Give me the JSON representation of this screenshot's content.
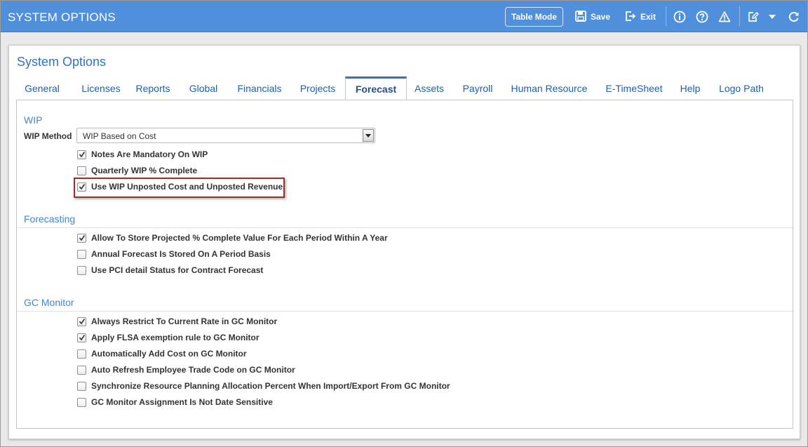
{
  "header": {
    "title": "SYSTEM OPTIONS",
    "table_mode_label": "Table Mode",
    "save_label": "Save",
    "exit_label": "Exit"
  },
  "panel": {
    "title": "System Options"
  },
  "tabs": [
    {
      "label": "General"
    },
    {
      "label": "Licenses"
    },
    {
      "label": "Reports"
    },
    {
      "label": "Global"
    },
    {
      "label": "Financials"
    },
    {
      "label": "Projects"
    },
    {
      "label": "Forecast",
      "active": true
    },
    {
      "label": "Assets"
    },
    {
      "label": "Payroll"
    },
    {
      "label": "Human Resource"
    },
    {
      "label": "E-TimeSheet"
    },
    {
      "label": "Help"
    },
    {
      "label": "Logo Path"
    }
  ],
  "wip": {
    "section_title": "WIP",
    "method_label": "WIP Method",
    "method_value": "WIP Based on Cost",
    "options": [
      {
        "label": "Notes Are Mandatory On WIP",
        "checked": true
      },
      {
        "label": "Quarterly WIP % Complete",
        "checked": false
      },
      {
        "label": "Use WIP Unposted Cost and Unposted Revenue",
        "checked": true
      }
    ]
  },
  "forecasting": {
    "section_title": "Forecasting",
    "options": [
      {
        "label": "Allow To Store Projected % Complete Value For Each Period Within A Year",
        "checked": true
      },
      {
        "label": "Annual Forecast Is Stored On A Period Basis",
        "checked": false
      },
      {
        "label": "Use PCI detail Status for Contract Forecast",
        "checked": false
      }
    ]
  },
  "gc_monitor": {
    "section_title": "GC Monitor",
    "options": [
      {
        "label": "Always Restrict To Current Rate in GC Monitor",
        "checked": true
      },
      {
        "label": "Apply FLSA exemption rule to GC Monitor",
        "checked": true
      },
      {
        "label": "Automatically Add Cost on GC Monitor",
        "checked": false
      },
      {
        "label": "Auto Refresh Employee Trade Code on GC Monitor",
        "checked": false
      },
      {
        "label": "Synchronize Resource Planning Allocation Percent When Import/Export From GC Monitor",
        "checked": false
      },
      {
        "label": "GC Monitor Assignment Is Not Date Sensitive",
        "checked": false
      }
    ]
  },
  "colors": {
    "header_bg": "#4f8fdb",
    "link_blue": "#1d5fae",
    "section_blue": "#3f86d4",
    "highlight_red": "#a22b2b"
  }
}
